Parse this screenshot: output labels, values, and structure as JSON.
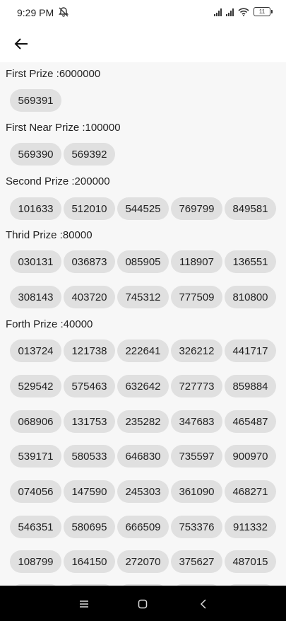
{
  "status_bar": {
    "time": "9:29 PM",
    "battery": "11",
    "icons": [
      "mute-icon",
      "signal-icon",
      "signal-icon",
      "wifi-icon",
      "battery-icon"
    ]
  },
  "app_bar": {
    "back_icon": "arrow-left-icon"
  },
  "sections": [
    {
      "title": "First Prize :6000000",
      "numbers": [
        "569391"
      ]
    },
    {
      "title": "First Near Prize :100000",
      "numbers": [
        "569390",
        "569392"
      ]
    },
    {
      "title": "Second Prize :200000",
      "numbers": [
        "101633",
        "512010",
        "544525",
        "769799",
        "849581"
      ]
    },
    {
      "title": "Thrid Prize :80000",
      "numbers": [
        "030131",
        "036873",
        "085905",
        "118907",
        "136551",
        "308143",
        "403720",
        "745312",
        "777509",
        "810800"
      ]
    },
    {
      "title": "Forth Prize :40000",
      "numbers": [
        "013724",
        "121738",
        "222641",
        "326212",
        "441717",
        "529542",
        "575463",
        "632642",
        "727773",
        "859884",
        "068906",
        "131753",
        "235282",
        "347683",
        "465487",
        "539171",
        "580533",
        "646830",
        "735597",
        "900970",
        "074056",
        "147590",
        "245303",
        "361090",
        "468271",
        "546351",
        "580695",
        "666509",
        "753376",
        "911332",
        "108799",
        "164150",
        "272070",
        "375627",
        "487015"
      ]
    }
  ],
  "nav_bar": {
    "icons": [
      "menu-icon",
      "home-icon",
      "back-icon"
    ]
  },
  "colors": {
    "chip_bg": "#e0e0e0",
    "content_bg": "#f7f7f7",
    "nav_bg": "#000000"
  }
}
